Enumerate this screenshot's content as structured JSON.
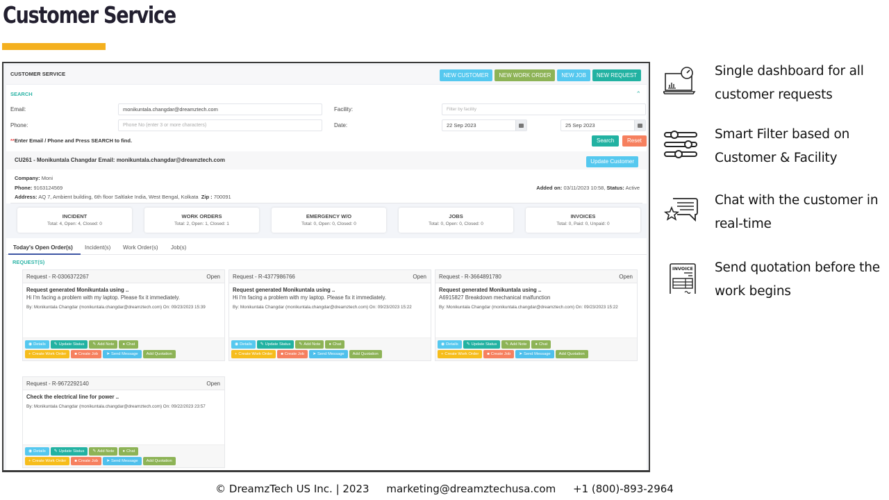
{
  "slide": {
    "title": "Customer Service",
    "accent_color": "#f4b01e"
  },
  "app": {
    "header": {
      "title": "CUSTOMER SERVICE",
      "buttons": [
        {
          "label": "NEW CUSTOMER",
          "color": "#55c8ef"
        },
        {
          "label": "NEW WORK ORDER",
          "color": "#8db356"
        },
        {
          "label": "NEW JOB",
          "color": "#55c8ef"
        },
        {
          "label": "NEW REQUEST",
          "color": "#22b2a2"
        }
      ]
    },
    "search": {
      "section_label": "SEARCH",
      "email_label": "Email:",
      "email_value": "monikuntala.changdar@dreamztech.com",
      "phone_label": "Phone:",
      "phone_placeholder": "Phone No (enter 3 or more characters)",
      "facility_label": "Facility:",
      "facility_placeholder": "Filter by facility",
      "date_label": "Date:",
      "date_from": "22 Sep 2023",
      "date_to": "25 Sep 2023",
      "hint_star": "**",
      "hint": "Enter Email / Phone and Press SEARCH to find.",
      "search_button": "Search",
      "reset_button": "Reset"
    },
    "customer": {
      "title": "CU261 - Monikuntala Changdar Email: monikuntala.changdar@dreamztech.com",
      "update_button": "Update Customer",
      "company_label": "Company:",
      "company": "Moni",
      "phone_label": "Phone:",
      "phone": "9163124569",
      "address_label": "Address:",
      "address": "AQ 7, Ambient building, 6th floor Saltlake   India, West Bengal, Kolkata",
      "zip_label": "Zip :",
      "zip": "700091",
      "added_label": "Added on:",
      "added_on": "03/11/2023 10:58,",
      "status_label": "Status:",
      "status": "Active"
    },
    "stats": [
      {
        "title": "INCIDENT",
        "summary": "Total: 4, Open: 4, Closed: 0"
      },
      {
        "title": "WORK ORDERS",
        "summary": "Total: 2, Open: 1, Closed: 1"
      },
      {
        "title": "EMERGENCY W/O",
        "summary": "Total: 0, Open: 0, Closed: 0"
      },
      {
        "title": "JOBS",
        "summary": "Total: 0, Open: 0, Closed: 0"
      },
      {
        "title": "INVOICES",
        "summary": "Total: 0, Paid: 0, Unpaid: 0"
      }
    ],
    "tabs": [
      {
        "label": "Today's Open Order(s)",
        "active": true
      },
      {
        "label": "Incident(s)",
        "active": false
      },
      {
        "label": "Work Order(s)",
        "active": false
      },
      {
        "label": "Job(s)",
        "active": false
      }
    ],
    "requests_label": "REQUEST(S)",
    "request_actions": {
      "details": "Details",
      "update_status": "Update Status",
      "add_note": "Add Note",
      "chat": "Chat",
      "create_work_order": "Create Work Order",
      "create_job": "Create Job",
      "send_message": "Send Message",
      "add_quotation": "Add Quotation"
    },
    "requests": [
      {
        "id": "Request - R-0306372267",
        "status": "Open",
        "subject": "Request generated Monikuntala using ..",
        "description": "Hi I'm facing a problem with my laptop. Please fix it immediately.",
        "meta": "By: Monikuntala Changdar (monikuntala.changdar@dreamztech.com)  On: 09/23/2023 15:39"
      },
      {
        "id": "Request - R-4377986766",
        "status": "Open",
        "subject": "Request generated Monikuntala using ..",
        "description": "Hi I'm facing a problem with my laptop. Please fix it immediately.",
        "meta": "By: Monikuntala Changdar (monikuntala.changdar@dreamztech.com)  On: 09/23/2023 15:22"
      },
      {
        "id": "Request - R-3664891780",
        "status": "Open",
        "subject": "Request generated Monikuntala using ..",
        "description": "A6915827 Breakdown mechanical malfunction",
        "meta": "By: Monikuntala Changdar (monikuntala.changdar@dreamztech.com)  On: 09/23/2023 15:22"
      },
      {
        "id": "Request - R-9672292140",
        "status": "Open",
        "subject": "Check the electrical line for power ..",
        "description": "",
        "meta": "By: Monikuntala Changdar (monikuntala.changdar@dreamztech.com)  On: 09/22/2023 23:57"
      }
    ]
  },
  "features": [
    {
      "icon": "dashboard-laptop-icon",
      "line1": "Single dashboard for all",
      "line2": "customer requests"
    },
    {
      "icon": "filter-sliders-icon",
      "line1": "Smart Filter based on",
      "line2": "Customer & Facility"
    },
    {
      "icon": "chat-star-icon",
      "line1": "Chat with the customer in",
      "line2": "real-time"
    },
    {
      "icon": "invoice-icon",
      "line1": "Send quotation before the",
      "line2": "work begins"
    }
  ],
  "footer": {
    "copyright": "© DreamzTech US Inc. | 2023",
    "email": "marketing@dreamztechusa.com",
    "phone": "+1 (800)-893-2964"
  }
}
